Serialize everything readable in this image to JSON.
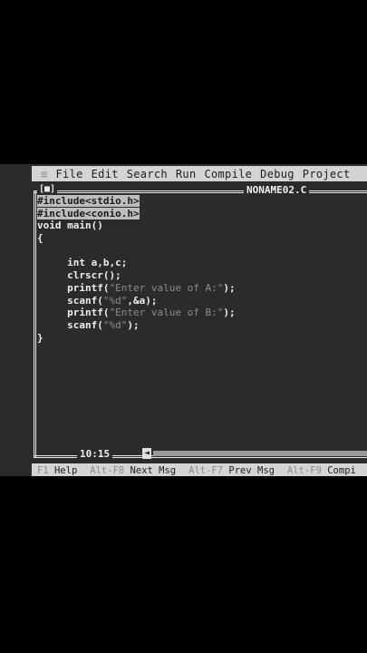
{
  "menu": {
    "system": "≡",
    "items": [
      "File",
      "Edit",
      "Search",
      "Run",
      "Compile",
      "Debug",
      "Project"
    ]
  },
  "window": {
    "close_box": "[■]",
    "filename": "NONAME02.C"
  },
  "code_lines": [
    {
      "text": "#include<stdio.h>",
      "highlight": true
    },
    {
      "text": "#include<conio.h>",
      "highlight": true
    },
    {
      "text": "void main()",
      "highlight": false
    },
    {
      "text": "{",
      "highlight": false
    },
    {
      "text": "",
      "highlight": false
    },
    {
      "text": "     int a,b,c;",
      "highlight": false
    },
    {
      "text": "     clrscr();",
      "highlight": false
    },
    {
      "text": "     printf(\"Enter value of A:\");",
      "highlight": false
    },
    {
      "text": "     scanf(\"%d\",&a);",
      "highlight": false
    },
    {
      "text": "     printf(\"Enter value of B:\");",
      "highlight": false
    },
    {
      "text": "     scanf(\"%d\");",
      "highlight": false
    },
    {
      "text": "}",
      "highlight": false
    }
  ],
  "status": {
    "position": "10:15",
    "scroll_arrow": "◄"
  },
  "function_keys": [
    {
      "key": "F1",
      "action": "Help"
    },
    {
      "key": "Alt-F8",
      "action": "Next Msg"
    },
    {
      "key": "Alt-F7",
      "action": "Prev Msg"
    },
    {
      "key": "Alt-F9",
      "action": "Compi"
    }
  ]
}
